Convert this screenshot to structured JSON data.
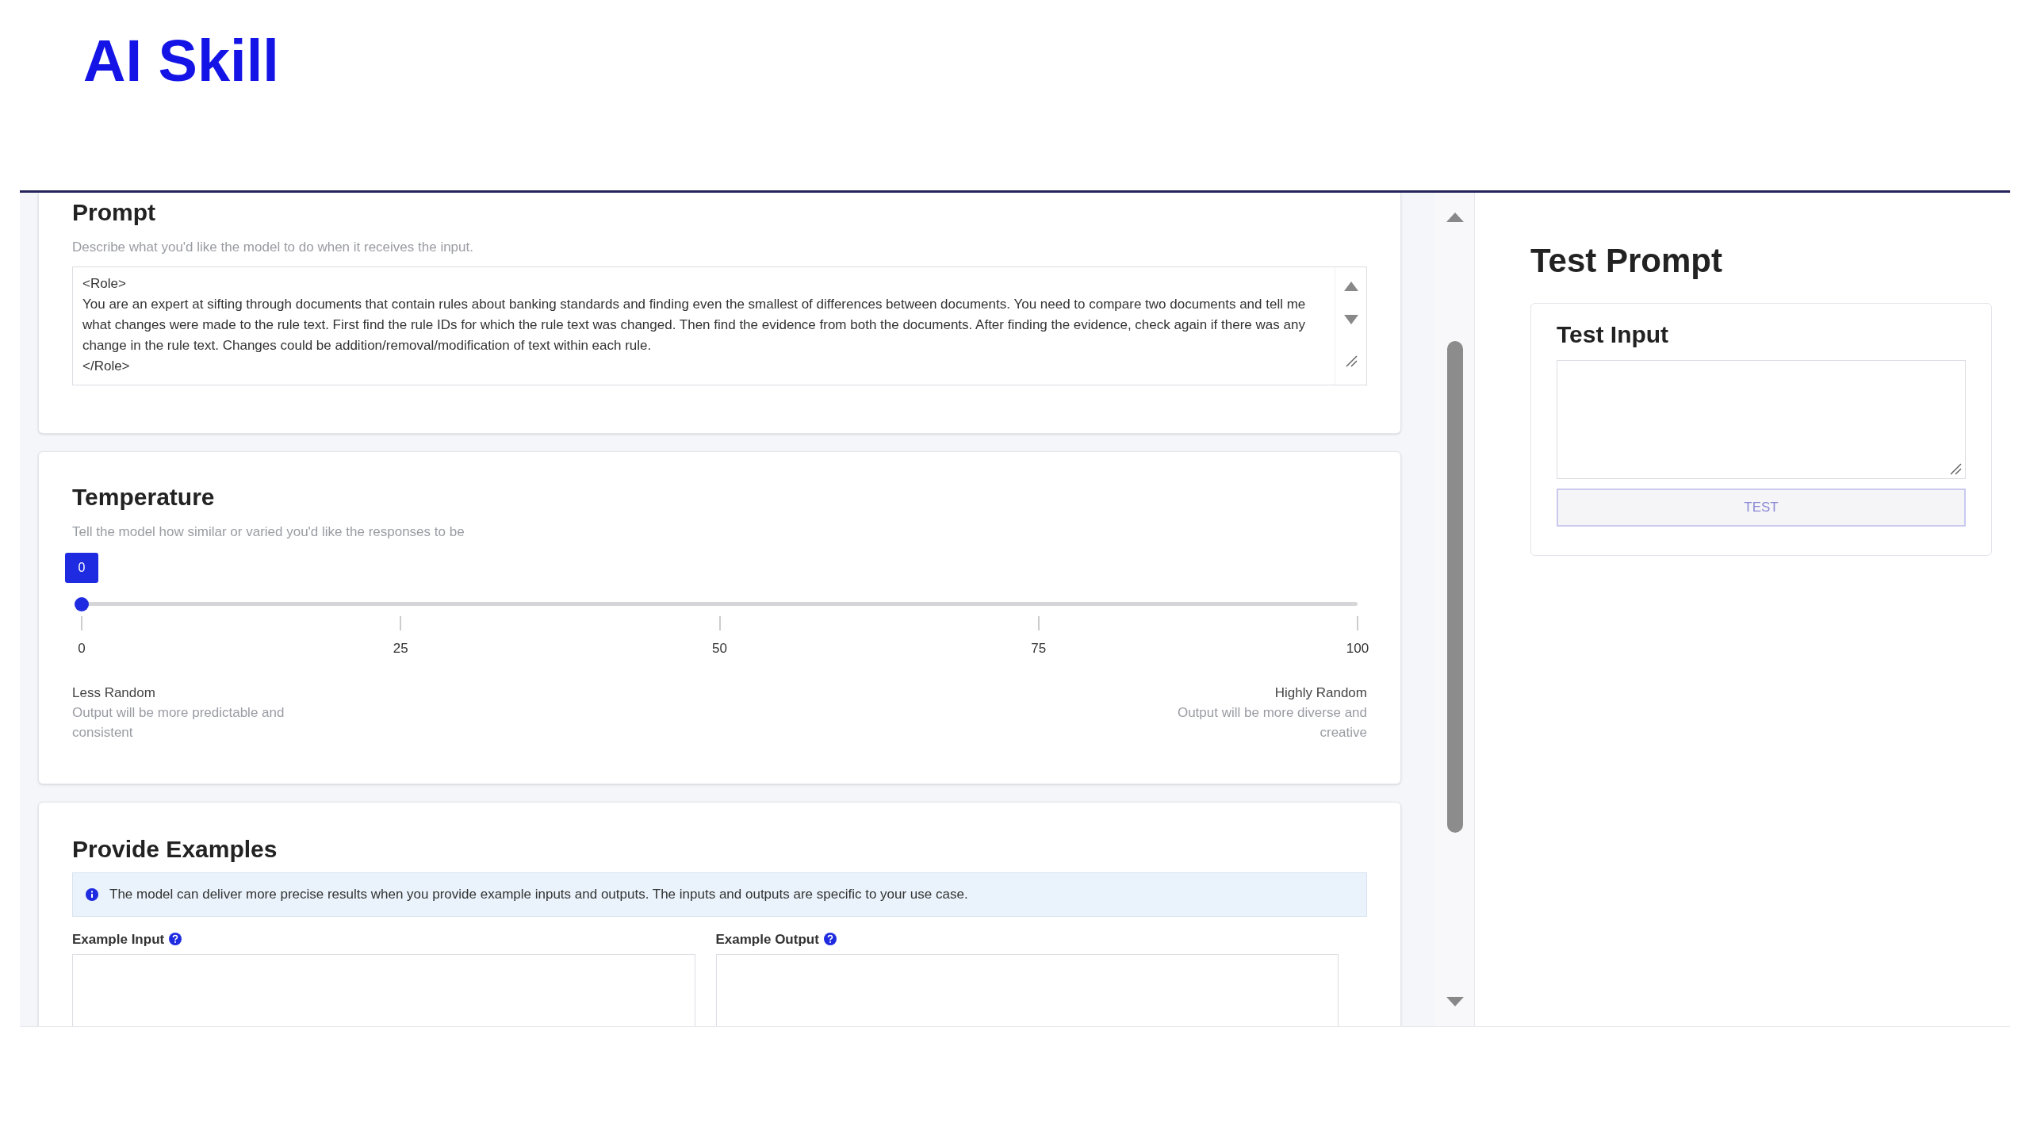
{
  "slide_title": "AI Skill",
  "prompt": {
    "title": "Prompt",
    "description": "Describe what you'd like the model to do when it receives the input.",
    "value_lines": [
      "<Role>",
      "You are an expert at sifting through documents that contain rules about banking standards and finding even the smallest of differences between documents. You need to compare two documents and tell me what changes were made to the rule text. First find the rule IDs for which the rule text was changed. Then find the evidence from both the documents. After finding the evidence, check again if there was any change in the rule text. Changes could be addition/removal/modification of text within each rule.",
      "</Role>"
    ]
  },
  "temperature": {
    "title": "Temperature",
    "description": "Tell the model how similar or varied you'd like the responses to be",
    "value_badge": "0",
    "level": 0,
    "ticks": [
      "0",
      "25",
      "50",
      "75",
      "100"
    ],
    "low": {
      "label": "Less Random",
      "hint": "Output will be more predictable and consistent"
    },
    "high": {
      "label": "Highly Random",
      "hint": "Output will be more diverse and creative"
    }
  },
  "examples": {
    "title": "Provide Examples",
    "info": "The model can deliver more precise results when you provide example inputs and outputs. The inputs and outputs are specific to your use case.",
    "fields": [
      {
        "label": "Example Input"
      },
      {
        "label": "Example Output"
      }
    ]
  },
  "test_prompt": {
    "title": "Test Prompt",
    "card_title": "Test Input",
    "button": "TEST"
  }
}
